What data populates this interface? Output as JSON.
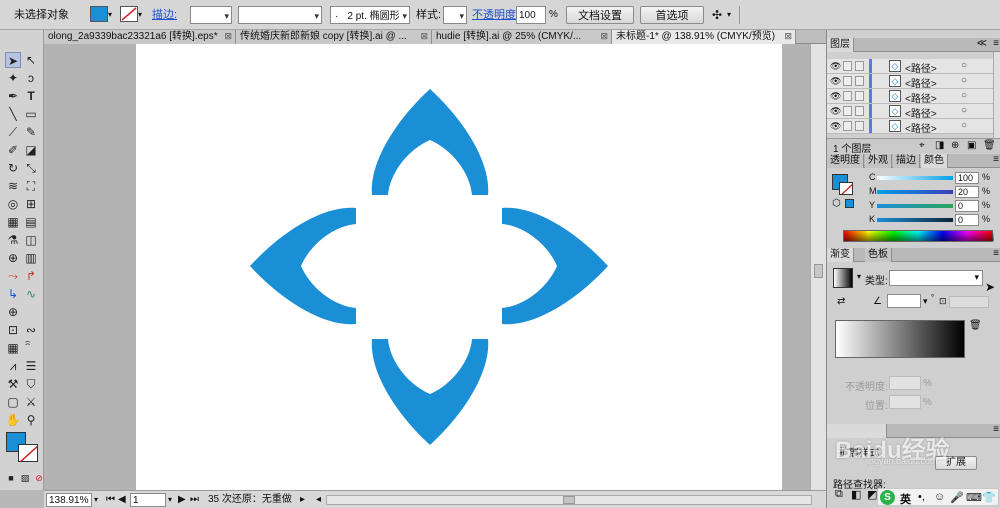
{
  "control_bar": {
    "selection_status": "未选择对象",
    "fill_color": "#1b8fd6",
    "stroke_label": "描边:",
    "stroke_profile_value": "2 pt. 椭圆形",
    "style_label": "样式:",
    "opacity_label": "不透明度:",
    "opacity_value": "100",
    "opacity_unit": "%",
    "doc_setup_button": "文档设置",
    "preferences_button": "首选项"
  },
  "tabs": [
    {
      "label": "olong_2a9339bac23321a6 [转换].eps*",
      "close": "⊠"
    },
    {
      "label": "传统婚庆新郎新娘 copy [转换].ai @ ...",
      "close": "⊠"
    },
    {
      "label": "hudie [转换].ai @ 25% (CMYK/...",
      "close": "⊠"
    },
    {
      "label": "未标题-1* @ 138.91% (CMYK/预览)",
      "close": "⊠"
    }
  ],
  "artwork": {
    "color": "#1b8fd6"
  },
  "status_bar": {
    "zoom": "138.91%",
    "page": "1",
    "undo_status": "35 次还原：无重做"
  },
  "layers_panel": {
    "title": "图层",
    "rows": [
      {
        "name": "<路径>",
        "glyph": "◇"
      },
      {
        "name": "<路径>",
        "glyph": "◇"
      },
      {
        "name": "<路径>",
        "glyph": "◇"
      },
      {
        "name": "<路径>",
        "glyph": "◇"
      },
      {
        "name": "<路径>",
        "glyph": "◇"
      }
    ],
    "layer_count": "1 个图层"
  },
  "color_panel": {
    "tabs": [
      "透明度",
      "外观",
      "描边",
      "颜色"
    ],
    "fill_color": "#1b8fd6",
    "sliders": [
      {
        "label": "C",
        "value": "100",
        "unit": "%"
      },
      {
        "label": "M",
        "value": "20",
        "unit": "%"
      },
      {
        "label": "Y",
        "value": "0",
        "unit": "%"
      },
      {
        "label": "K",
        "value": "0",
        "unit": "%"
      }
    ]
  },
  "gradient_panel": {
    "tabs": [
      "渐变",
      "色板"
    ],
    "type_label": "类型:",
    "opacity_label": "不透明度:",
    "opacity_unit": "%",
    "position_label": "位置:",
    "position_unit": "%"
  },
  "bottom_panel": {
    "items": [
      "扩展样式",
      "扩展"
    ],
    "section_label": "路径查找器:"
  },
  "watermark": {
    "text": "Baidu经验",
    "url": "jingyan.baidu.com"
  },
  "taskbar": {
    "ime": "英"
  }
}
